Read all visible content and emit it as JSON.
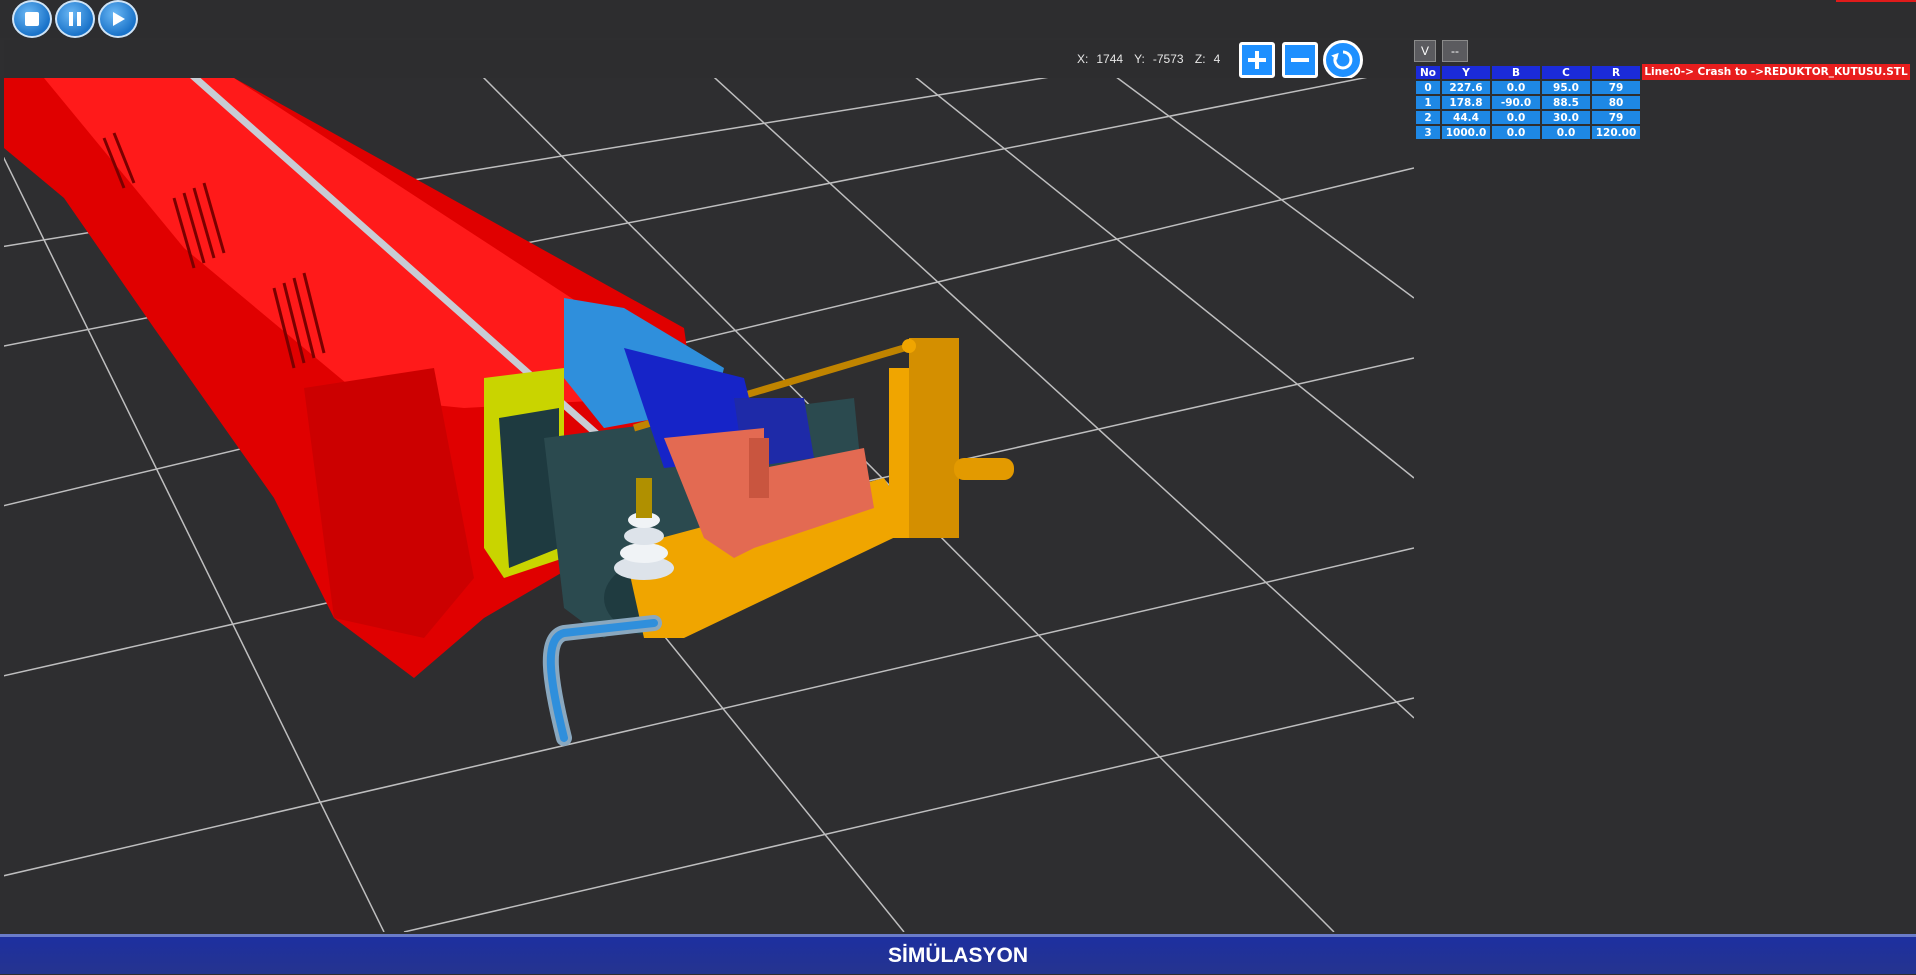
{
  "toolbar": {
    "buttons": [
      {
        "name": "stop",
        "icon": "stop-icon"
      },
      {
        "name": "pause",
        "icon": "pause-icon"
      },
      {
        "name": "play",
        "icon": "play-icon"
      }
    ]
  },
  "coordinates": {
    "x_label": "X:",
    "x_value": "1744",
    "y_label": "Y:",
    "y_value": "-7573",
    "z_label": "Z:",
    "z_value": "4"
  },
  "view_controls": {
    "zoom_in_icon": "plus-icon",
    "zoom_out_icon": "minus-icon",
    "reset_icon": "rotate-reset-icon"
  },
  "panel": {
    "v_button": "V",
    "dash_button": "--",
    "table": {
      "headers": [
        "No",
        "Y",
        "B",
        "C",
        "R"
      ],
      "rows": [
        [
          "0",
          "227.6",
          "0.0",
          "95.0",
          "79"
        ],
        [
          "1",
          "178.8",
          "-90.0",
          "88.5",
          "80"
        ],
        [
          "2",
          "44.4",
          "0.0",
          "30.0",
          "79"
        ],
        [
          "3",
          "1000.0",
          "0.0",
          "0.0",
          "120.00"
        ]
      ]
    },
    "crash_message": "Line:0-> Crash to ->REDUKTOR_KUTUSU.STL"
  },
  "footer": {
    "title": "SİMÜLASYON"
  },
  "colors": {
    "machine_body": "#ff0000",
    "bend_head": "#f0a500",
    "clamp": "#2f8fdc",
    "pressure_die": "#e36a52",
    "viewport_bg": "#2e2e30",
    "grid": "#d8d8d8",
    "footer_bg": "#23339a",
    "table_header": "#1b2bd9",
    "table_cell": "#1e88e5",
    "crash_badge": "#e81d1d"
  }
}
